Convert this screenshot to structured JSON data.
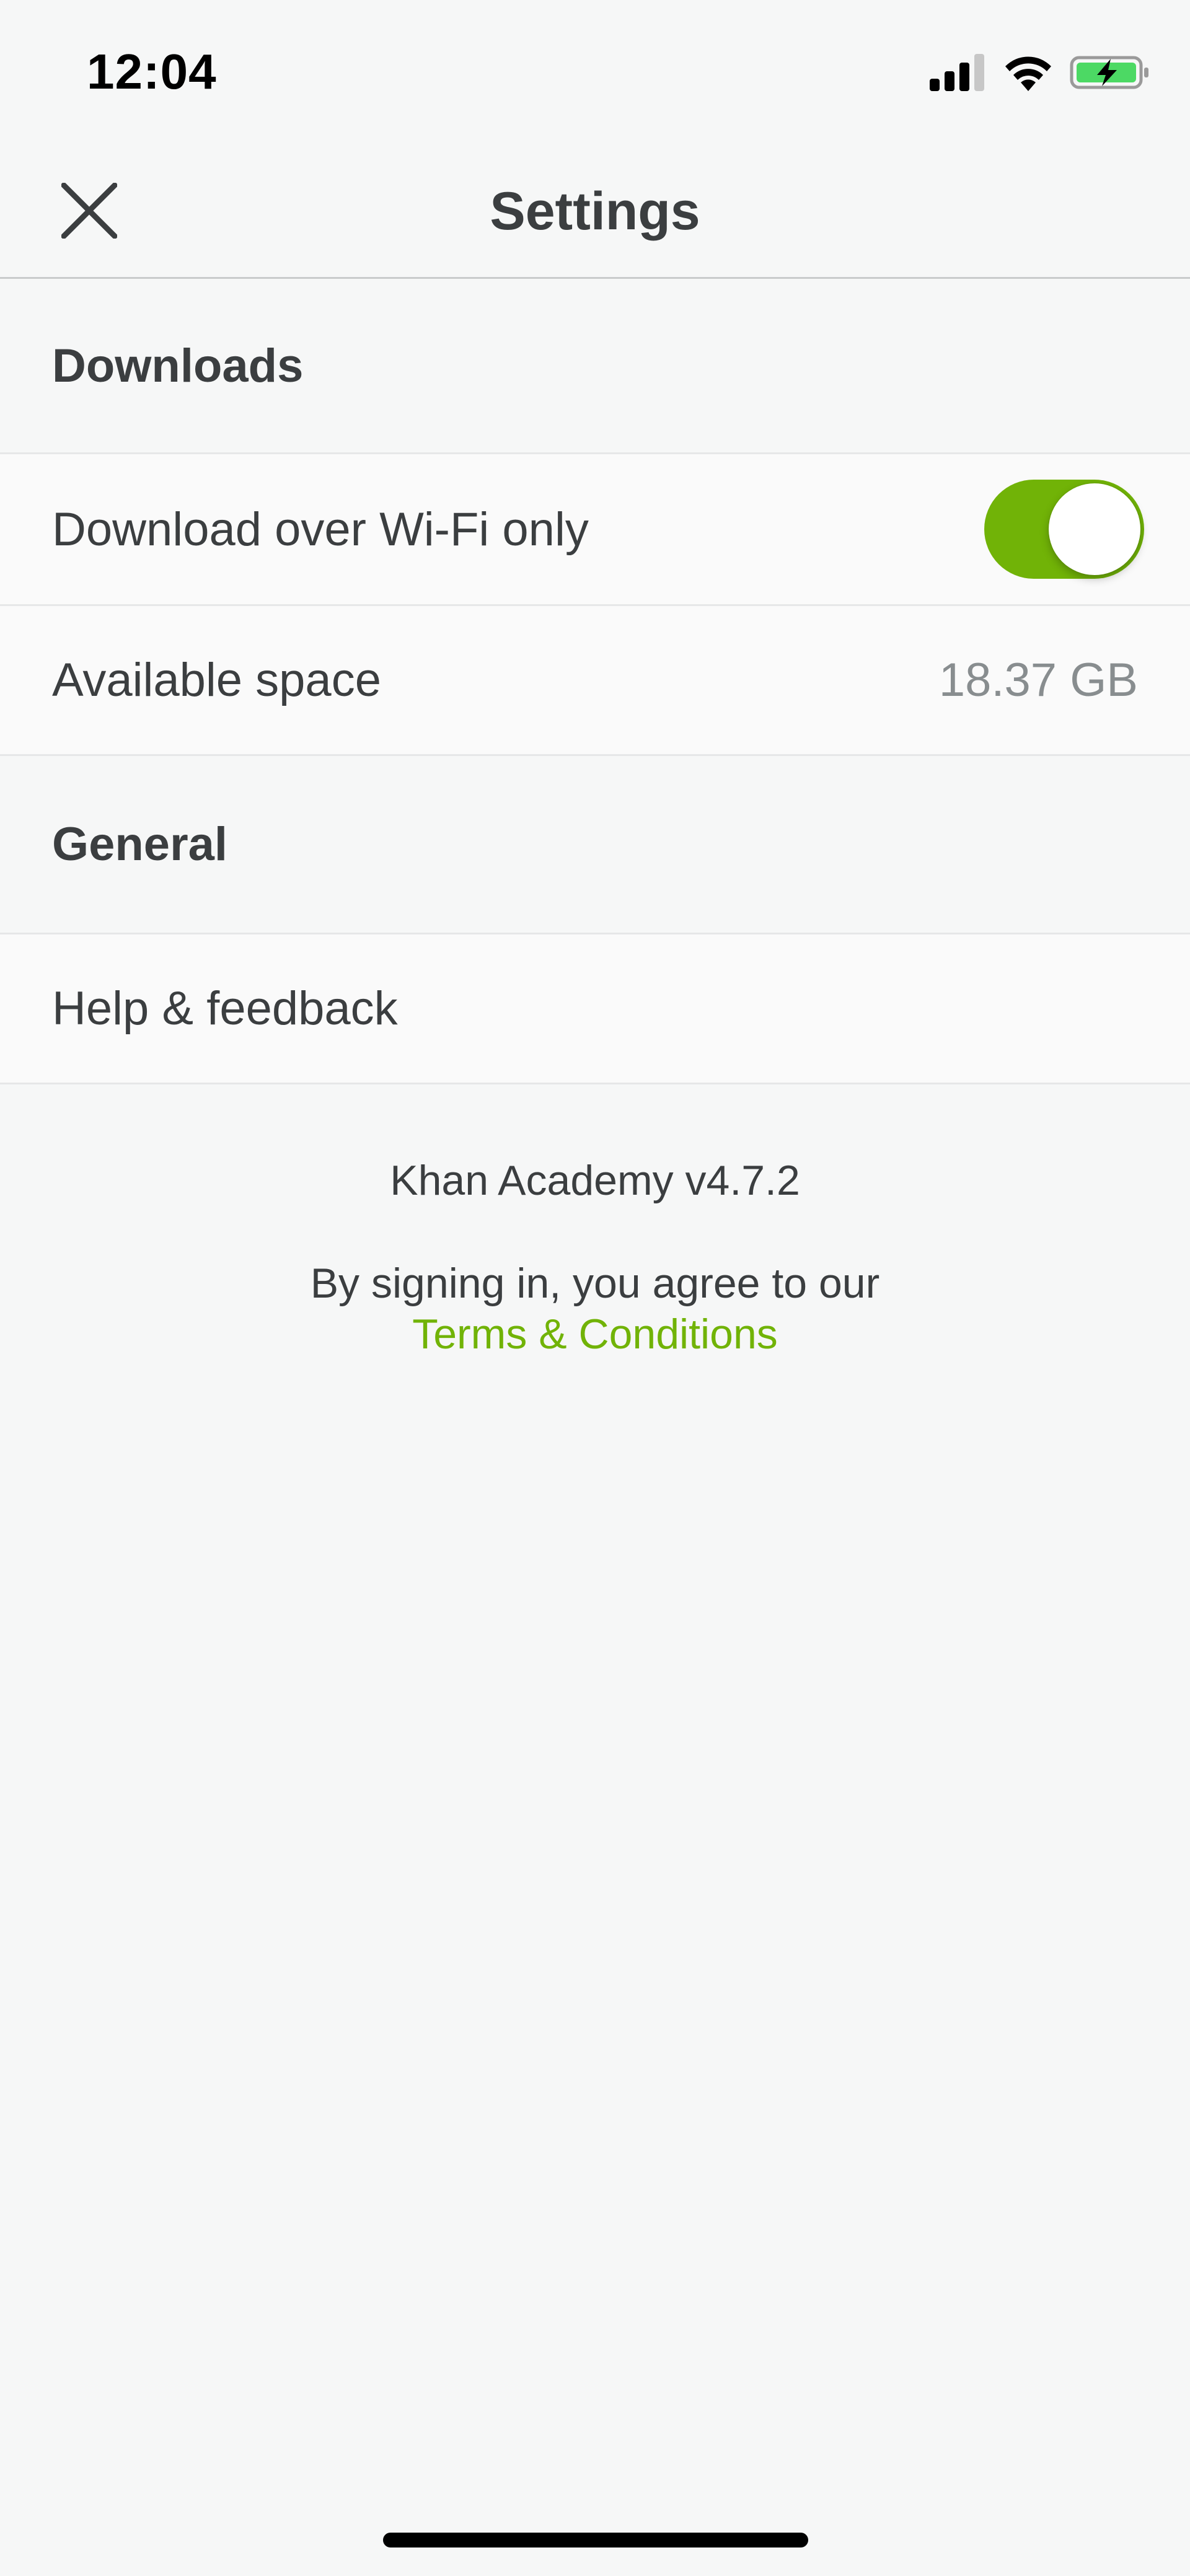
{
  "status_bar": {
    "time": "12:04",
    "icons": [
      "cellular-signal-icon",
      "wifi-icon",
      "battery-charging-icon"
    ]
  },
  "nav": {
    "title": "Settings",
    "close_icon": "close-icon"
  },
  "sections": {
    "downloads": {
      "header": "Downloads",
      "wifi_only": {
        "label": "Download over Wi-Fi only",
        "enabled": true
      },
      "available_space": {
        "label": "Available space",
        "value": "18.37 GB"
      }
    },
    "general": {
      "header": "General",
      "help": {
        "label": "Help & feedback"
      }
    }
  },
  "footer": {
    "version": "Khan Academy v4.7.2",
    "legal_text": "By signing in, you agree to our",
    "terms_link": "Terms & Conditions"
  },
  "colors": {
    "accent": "#71b307",
    "background": "#f6f7f7",
    "row_background": "#fafafa",
    "text": "#3b3e40",
    "secondary_text": "#888d8f"
  }
}
